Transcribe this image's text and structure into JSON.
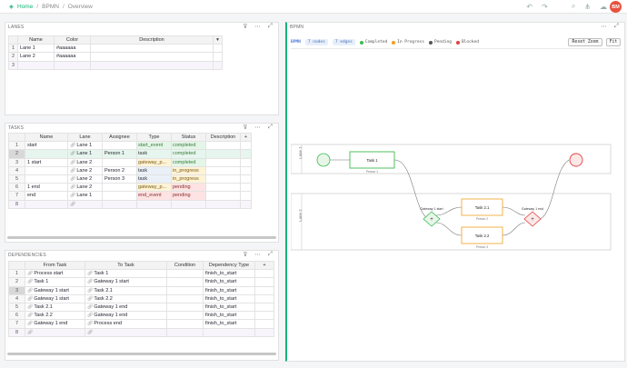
{
  "breadcrumb": {
    "home": "Home",
    "doc": "BPMN",
    "page": "Overview"
  },
  "user": {
    "initials": "BM"
  },
  "lanes_panel": {
    "title": "LANES",
    "columns": [
      "Name",
      "Color",
      "Description"
    ],
    "rows": [
      {
        "n": "1",
        "name": "Lane 1",
        "color": "#aaaaaa",
        "desc": ""
      },
      {
        "n": "2",
        "name": "Lane 2",
        "color": "#aaaaaa",
        "desc": ""
      },
      {
        "n": "3",
        "name": "",
        "color": "",
        "desc": ""
      }
    ]
  },
  "tasks_panel": {
    "title": "TASKS",
    "columns": [
      "Name",
      "Lane",
      "Assignee",
      "Type",
      "Status",
      "Description"
    ],
    "rows": [
      {
        "n": "1",
        "name": "start",
        "lane": "Lane 1",
        "assignee": "",
        "type": "start_event",
        "status": "completed"
      },
      {
        "n": "2",
        "name": "",
        "lane": "Lane 1",
        "assignee": "Person 1",
        "type": "task",
        "status": "completed"
      },
      {
        "n": "3",
        "name": "1 start",
        "lane": "Lane 2",
        "assignee": "",
        "type": "gateway_p...",
        "status": "completed"
      },
      {
        "n": "4",
        "name": "",
        "lane": "Lane 2",
        "assignee": "Person 2",
        "type": "task",
        "status": "in_progress"
      },
      {
        "n": "5",
        "name": "",
        "lane": "Lane 2",
        "assignee": "Person 3",
        "type": "task",
        "status": "in_progress"
      },
      {
        "n": "6",
        "name": "1 end",
        "lane": "Lane 2",
        "assignee": "",
        "type": "gateway_p...",
        "status": "pending"
      },
      {
        "n": "7",
        "name": "end",
        "lane": "Lane 1",
        "assignee": "",
        "type": "end_event",
        "status": "pending"
      },
      {
        "n": "8",
        "name": "",
        "lane": "",
        "assignee": "",
        "type": "",
        "status": ""
      }
    ]
  },
  "deps_panel": {
    "title": "DEPENDENCIES",
    "columns": [
      "From Task",
      "To Task",
      "Condition",
      "Dependency Type"
    ],
    "rows": [
      {
        "n": "1",
        "from": "Process start",
        "to": "Task 1",
        "type": "finish_to_start"
      },
      {
        "n": "2",
        "from": "Task 1",
        "to": "Gateway 1 start",
        "type": "finish_to_start"
      },
      {
        "n": "3",
        "from": "Gateway 1 start",
        "to": "Task 2.1",
        "type": "finish_to_start"
      },
      {
        "n": "4",
        "from": "Gateway 1 start",
        "to": "Task 2.2",
        "type": "finish_to_start"
      },
      {
        "n": "5",
        "from": "Task 2.1",
        "to": "Gateway 1 end",
        "type": "finish_to_start"
      },
      {
        "n": "6",
        "from": "Task 2.2",
        "to": "Gateway 1 end",
        "type": "finish_to_start"
      },
      {
        "n": "7",
        "from": "Gateway 1 end",
        "to": "Process end",
        "type": "finish_to_start"
      },
      {
        "n": "8",
        "from": "",
        "to": "",
        "type": ""
      }
    ]
  },
  "bpmn": {
    "title": "BPMN",
    "logo": "BPMN",
    "nodes_pill": "7 nodes",
    "edges_pill": "7 edges",
    "legend": [
      {
        "label": "Completed",
        "color": "#3dbb4f"
      },
      {
        "label": "In Progress",
        "color": "#f0a020"
      },
      {
        "label": "Pending",
        "color": "#555555"
      },
      {
        "label": "Blocked",
        "color": "#e04040"
      }
    ],
    "reset_zoom": "Reset Zoom",
    "fit": "Fit",
    "lane1": "Lane 1",
    "lane2": "Lane 2",
    "task1": "Task 1",
    "task1_person": "Person 1",
    "task21": "Task 2.1",
    "task21_person": "Person 2",
    "task22": "Task 2.2",
    "task22_person": "Person 3",
    "gw_start": "Gateway 1 start",
    "gw_end": "Gateway 1 end"
  }
}
